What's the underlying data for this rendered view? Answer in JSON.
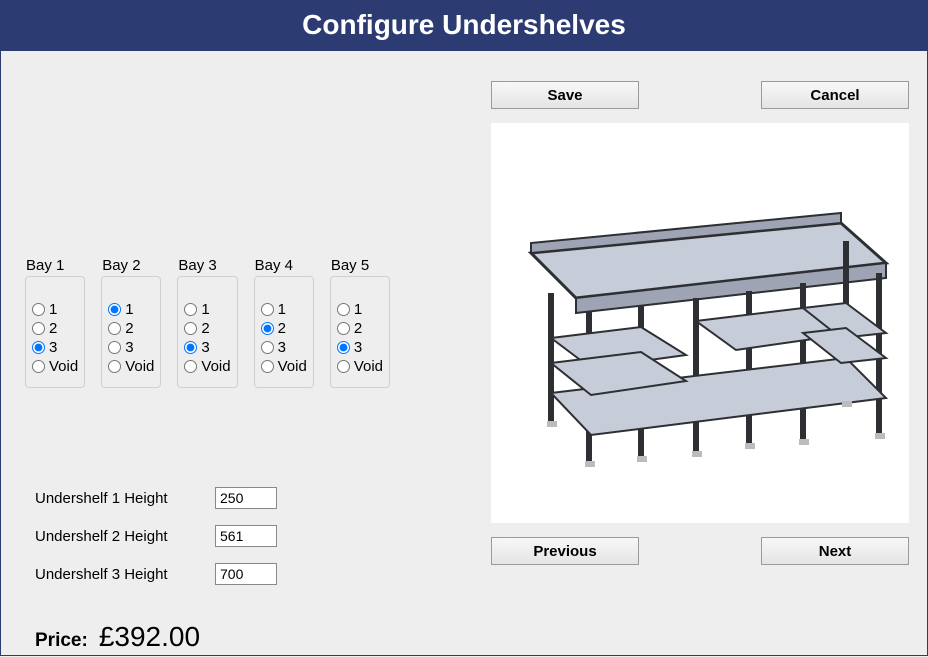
{
  "title": "Configure Undershelves",
  "buttons": {
    "save": "Save",
    "cancel": "Cancel",
    "previous": "Previous",
    "next": "Next"
  },
  "bays": [
    {
      "legend": "Bay 1",
      "options": [
        "1",
        "2",
        "3",
        "Void"
      ],
      "selected": "3"
    },
    {
      "legend": "Bay 2",
      "options": [
        "1",
        "2",
        "3",
        "Void"
      ],
      "selected": "1"
    },
    {
      "legend": "Bay 3",
      "options": [
        "1",
        "2",
        "3",
        "Void"
      ],
      "selected": "3"
    },
    {
      "legend": "Bay 4",
      "options": [
        "1",
        "2",
        "3",
        "Void"
      ],
      "selected": "2"
    },
    {
      "legend": "Bay 5",
      "options": [
        "1",
        "2",
        "3",
        "Void"
      ],
      "selected": "3"
    }
  ],
  "heights": [
    {
      "label": "Undershelf 1 Height",
      "value": "250"
    },
    {
      "label": "Undershelf 2 Height",
      "value": "561"
    },
    {
      "label": "Undershelf 3 Height",
      "value": "700"
    }
  ],
  "price": {
    "label": "Price:",
    "value": "£392.00"
  },
  "colors": {
    "titlebar": "#2d3b73",
    "frame_metal_light": "#c7ccd9",
    "frame_metal_dark": "#2e2f33"
  }
}
